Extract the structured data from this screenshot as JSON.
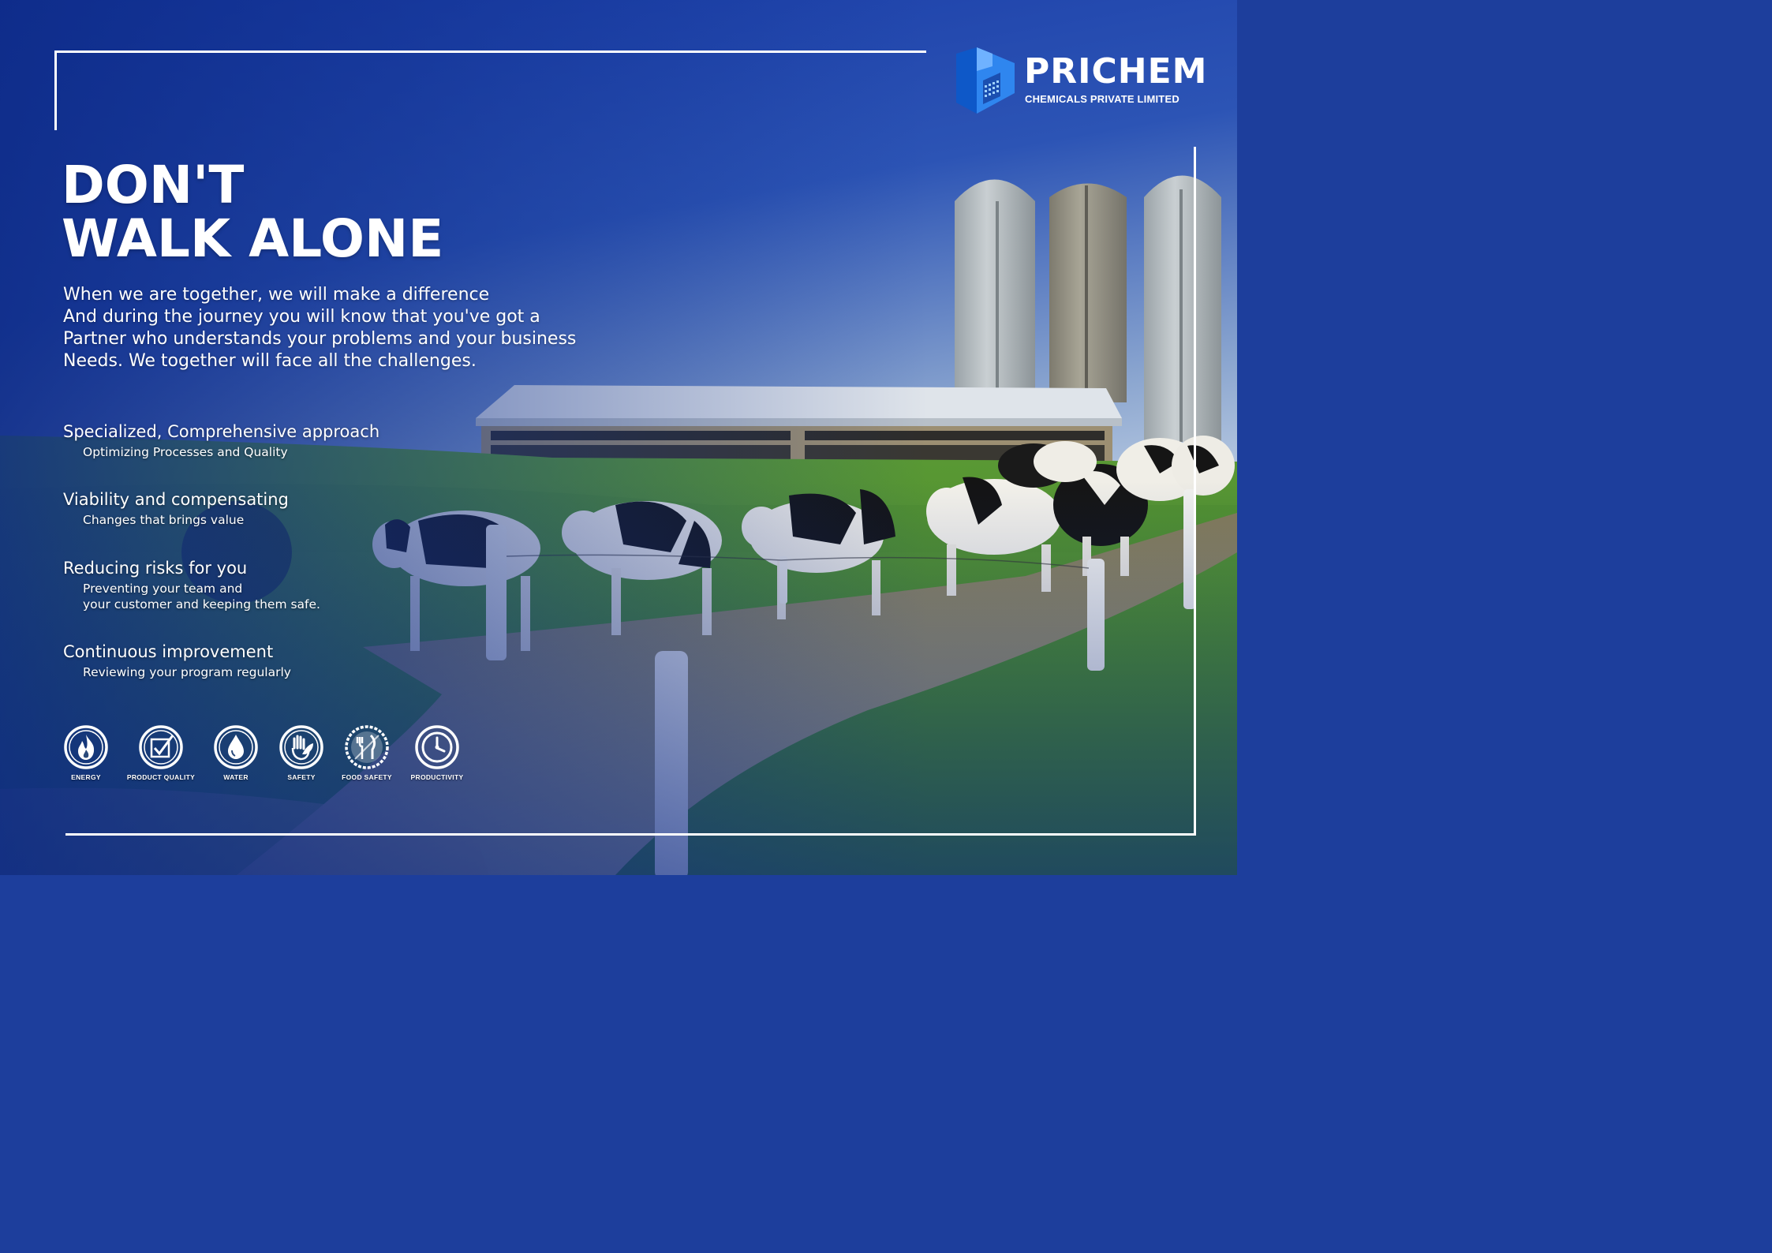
{
  "logo": {
    "name": "PRICHEM",
    "subtitle": "CHEMICALS PRIVATE LIMITED"
  },
  "headline": {
    "line1": "DON'T",
    "line2": "WALK ALONE"
  },
  "intro": {
    "lines": [
      "When we are together, we will make a difference",
      "And during the journey you will know that you've got a",
      "Partner who understands your problems and your business",
      "Needs. We together will face all the challenges."
    ]
  },
  "features": [
    {
      "title": "Specialized, Comprehensive approach",
      "desc": [
        "Optimizing Processes and Quality"
      ]
    },
    {
      "title": "Viability and compensating",
      "desc": [
        "Changes that brings value"
      ]
    },
    {
      "title": "Reducing risks for you",
      "desc": [
        "Preventing your team and",
        "your customer and keeping them safe."
      ]
    },
    {
      "title": "Continuous improvement",
      "desc": [
        "Reviewing your program regularly"
      ]
    }
  ],
  "icons": [
    {
      "label": "ENERGY",
      "icon": "flame-icon"
    },
    {
      "label": "PRODUCT QUALITY",
      "icon": "quality-check-icon"
    },
    {
      "label": "WATER",
      "icon": "water-drop-icon"
    },
    {
      "label": "SAFETY",
      "icon": "hand-leaf-icon"
    },
    {
      "label": "FOOD SAFETY",
      "icon": "fork-knife-icon"
    },
    {
      "label": "PRODUCTIVITY",
      "icon": "clock-icon"
    }
  ],
  "colors": {
    "sky_top": "#1a3fa8",
    "sky_bottom": "#b9cbe0",
    "grass": "#4f8f2c",
    "text": "#ffffff",
    "logo_blue": "#1d6fd8"
  }
}
